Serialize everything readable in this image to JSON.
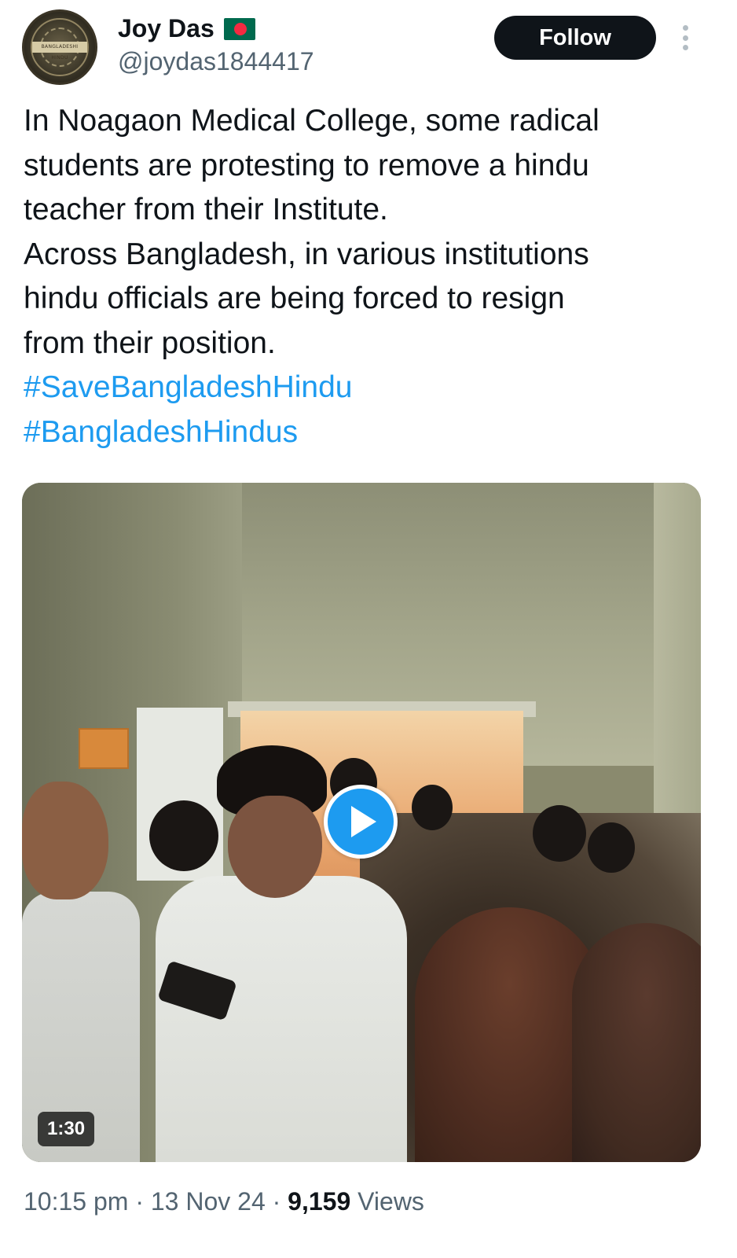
{
  "author": {
    "name": "Joy Das",
    "handle": "@joydas1844417",
    "avatar_label": "BANGLADESHI HINDU",
    "flag_icon": "bangladesh-flag-icon"
  },
  "actions": {
    "follow_label": "Follow",
    "more_icon": "more-vertical-icon"
  },
  "tweet": {
    "lines": [
      "In Noagaon Medical College, some radical",
      "students are protesting to remove a hindu",
      "teacher from their Institute.",
      "Across Bangladesh, in various institutions",
      "hindu officials are being forced to resign",
      "from their position."
    ],
    "hashtags": [
      "#SaveBangladeshHindu",
      "#BangladeshHindus"
    ]
  },
  "media": {
    "type": "video",
    "duration": "1:30",
    "play_icon": "play-icon"
  },
  "meta": {
    "time": "10:15 pm",
    "separator": " · ",
    "date": "13 Nov 24",
    "views_count": "9,159",
    "views_label": " Views"
  },
  "colors": {
    "text": "#0f1419",
    "secondary": "#536471",
    "link": "#1d9bf0",
    "button_bg": "#0f1419"
  }
}
